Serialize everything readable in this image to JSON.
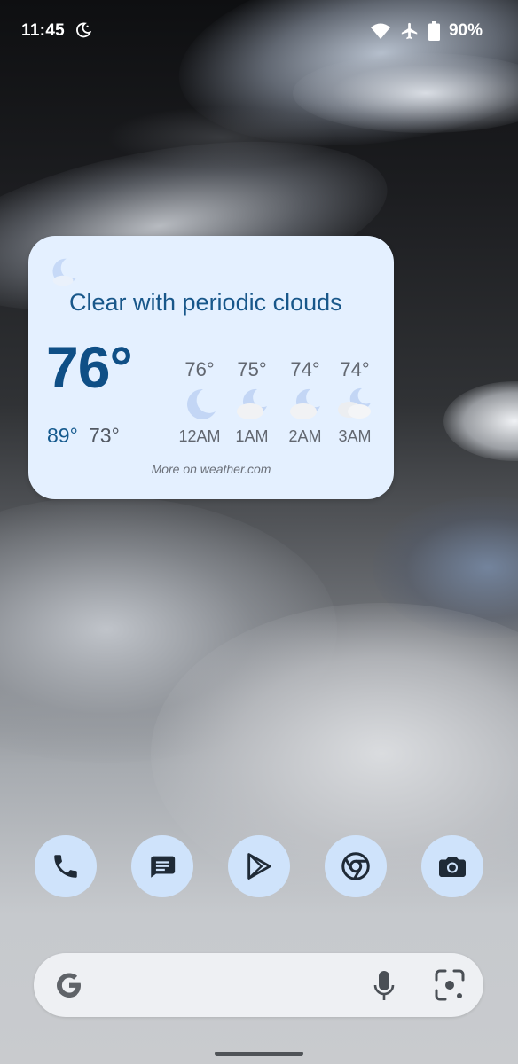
{
  "status_bar": {
    "time": "11:45",
    "icons": [
      "do-not-disturb-moon-icon",
      "wifi-icon",
      "airplane-mode-icon",
      "battery-icon"
    ],
    "battery_percent": "90%"
  },
  "weather_widget": {
    "condition": "Clear with periodic clouds",
    "current_temp": "76°",
    "high": "89°",
    "low": "73°",
    "hourly": [
      {
        "temp": "76°",
        "time": "12AM",
        "icon": "moon-icon"
      },
      {
        "temp": "75°",
        "time": "1AM",
        "icon": "moon-cloud-icon"
      },
      {
        "temp": "74°",
        "time": "2AM",
        "icon": "moon-cloud-icon"
      },
      {
        "temp": "74°",
        "time": "3AM",
        "icon": "moon-clouds-icon"
      }
    ],
    "source_link": "More on weather.com",
    "accent_color": "#0f4f86",
    "background_color": "#e4f0ff"
  },
  "dock": {
    "apps": [
      "phone-icon",
      "messages-icon",
      "play-store-icon",
      "chrome-icon",
      "camera-icon"
    ],
    "icon_background": "#cfe3fb",
    "icon_color": "#1f2a36"
  },
  "search_bar": {
    "icons": [
      "google-g-icon",
      "microphone-icon",
      "google-lens-icon"
    ]
  }
}
